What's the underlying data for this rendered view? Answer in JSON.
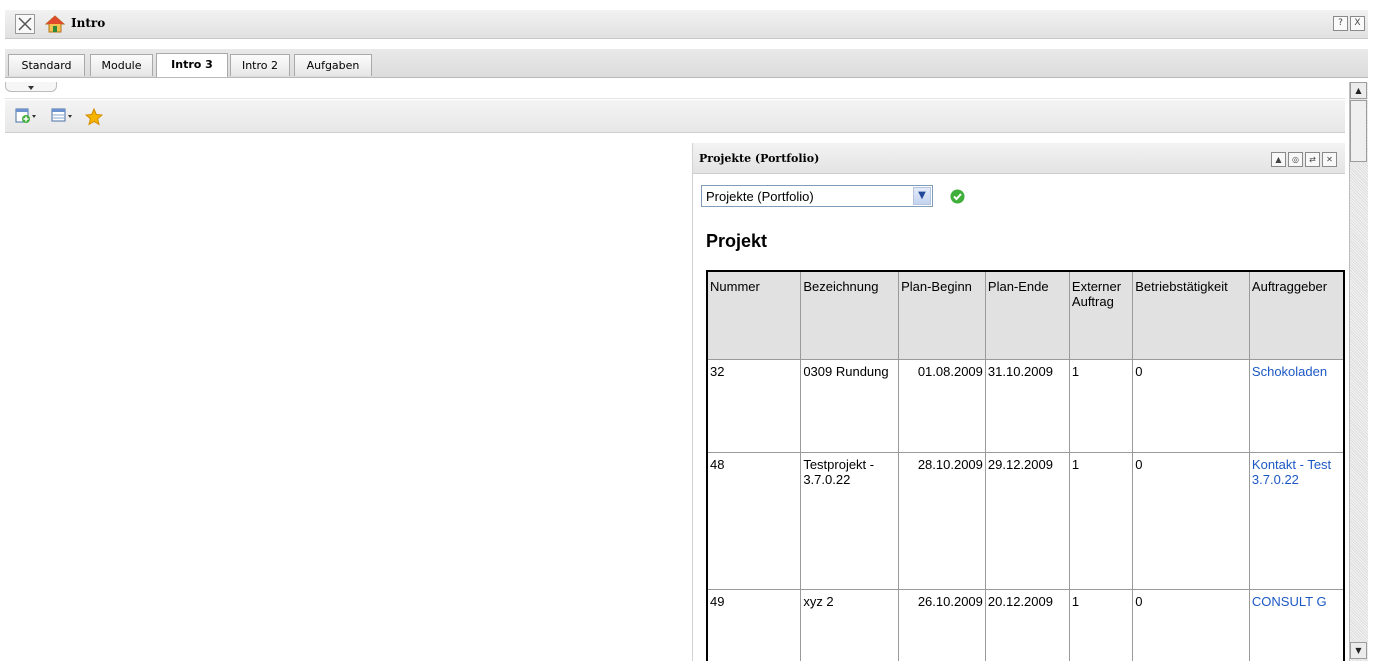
{
  "window": {
    "title": "Intro",
    "help_label": "?",
    "close_label": "X"
  },
  "tabs": [
    {
      "label": "Standard",
      "active": false
    },
    {
      "label": "Module",
      "active": false
    },
    {
      "label": "Intro 3",
      "active": true
    },
    {
      "label": "Intro 2",
      "active": false
    },
    {
      "label": "Aufgaben",
      "active": false
    }
  ],
  "toolbar": {
    "icons": [
      "add-portlet-icon",
      "layout-icon",
      "favorite-star-icon"
    ]
  },
  "portlet": {
    "title": "Projekte (Portfolio)",
    "select_value": "Projekte (Portfolio)",
    "heading": "Projekt",
    "columns": [
      "Nummer",
      "Bezeichnung",
      "Plan-Beginn",
      "Plan-Ende",
      "Externer Auftrag",
      "Betriebstätigkeit",
      "Auftraggeber"
    ],
    "rows": [
      {
        "nummer": "32",
        "bezeichnung": "0309 Rundung",
        "plan_beginn": "01.08.2009",
        "plan_ende": "31.10.2009",
        "extern": "1",
        "betrieb": "0",
        "auftraggeber": "Schokoladen"
      },
      {
        "nummer": "48",
        "bezeichnung": "Testprojekt - 3.7.0.22",
        "plan_beginn": "28.10.2009",
        "plan_ende": "29.12.2009",
        "extern": "1",
        "betrieb": "0",
        "auftraggeber": "Kontakt - Test 3.7.0.22"
      },
      {
        "nummer": "49",
        "bezeichnung": "xyz 2",
        "plan_beginn": "26.10.2009",
        "plan_ende": "20.12.2009",
        "extern": "1",
        "betrieb": "0",
        "auftraggeber": "CONSULT G"
      }
    ]
  },
  "colors": {
    "link": "#1c58c4",
    "ok_green": "#3fae3a",
    "star": "#f5b400"
  }
}
